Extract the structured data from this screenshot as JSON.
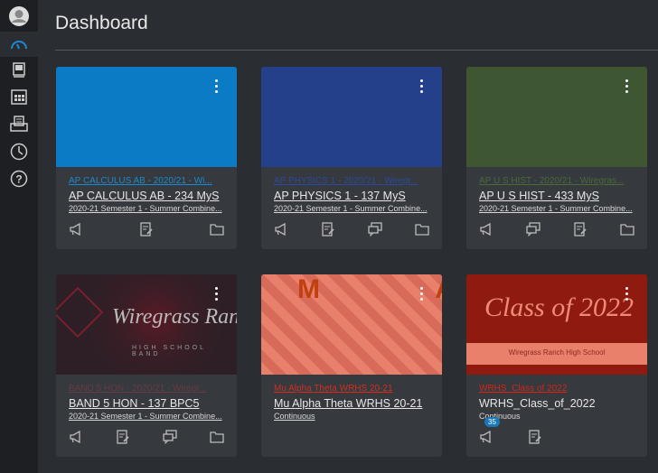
{
  "sidebar": {
    "items": [
      {
        "name": "account",
        "icon": "user-avatar-icon"
      },
      {
        "name": "dashboard",
        "icon": "dashboard-gauge-icon",
        "active": true
      },
      {
        "name": "courses",
        "icon": "book-icon"
      },
      {
        "name": "calendar",
        "icon": "calendar-icon"
      },
      {
        "name": "inbox",
        "icon": "inbox-icon"
      },
      {
        "name": "history",
        "icon": "clock-icon"
      },
      {
        "name": "help",
        "icon": "help-icon"
      }
    ]
  },
  "header": {
    "title": "Dashboard"
  },
  "cards": [
    {
      "code": "AP CALCULUS AB - 2020/21 - Wi...",
      "name": "AP CALCULUS AB - 234 MyS",
      "term": "2020-21 Semester 1 - Summer Combine...",
      "color": "#0a7bc4",
      "code_color": "#1a8ad0",
      "icons": [
        "announcements",
        "assignments",
        "files"
      ]
    },
    {
      "code": "AP PHYSICS 1 - 2020/21 - Wiregr...",
      "name": "AP PHYSICS 1 - 137 MyS",
      "term": "2020-21 Semester 1 - Summer Combine...",
      "color": "#24408a",
      "code_color": "#2c4a9a",
      "icons": [
        "announcements",
        "assignments",
        "discussions",
        "files"
      ]
    },
    {
      "code": "AP U S HIST - 2020/21 - Wiregras...",
      "name": "AP U S HIST - 433 MyS",
      "term": "2020-21 Semester 1 - Summer Combine...",
      "color": "#3e5632",
      "code_color": "#4a6a3a",
      "icons": [
        "announcements",
        "discussions",
        "assignments",
        "files"
      ]
    },
    {
      "code": "BAND 5 HON - 2020/21 - Wiregr...",
      "name": "BAND 5 HON - 137 BPC5",
      "term": "2020-21 Semester 1 - Summer Combine...",
      "color": "#2e1f26",
      "code_color": "#6a3a44",
      "image_text": "Wiregrass Ranch",
      "image_sub": "HIGH SCHOOL BAND",
      "icons": [
        "announcements",
        "assignments",
        "discussions",
        "files"
      ]
    },
    {
      "code": "Mu Alpha Theta WRHS 20-21",
      "name": "Mu Alpha Theta WRHS 20-21",
      "term": "Continuous",
      "color": "#e8806c",
      "code_color": "#d03020",
      "image_text": "M A Θ",
      "icons": []
    },
    {
      "code": "WRHS_Class of 2022",
      "name": "WRHS_Class_of_2022",
      "term": "Continuous",
      "color": "#9a1a10",
      "code_color": "#d02818",
      "image_text": "Class of 2022",
      "image_sub": "Wiregrass Ranch High School",
      "icons": [
        "announcements",
        "assignments"
      ],
      "badge": "35"
    }
  ]
}
